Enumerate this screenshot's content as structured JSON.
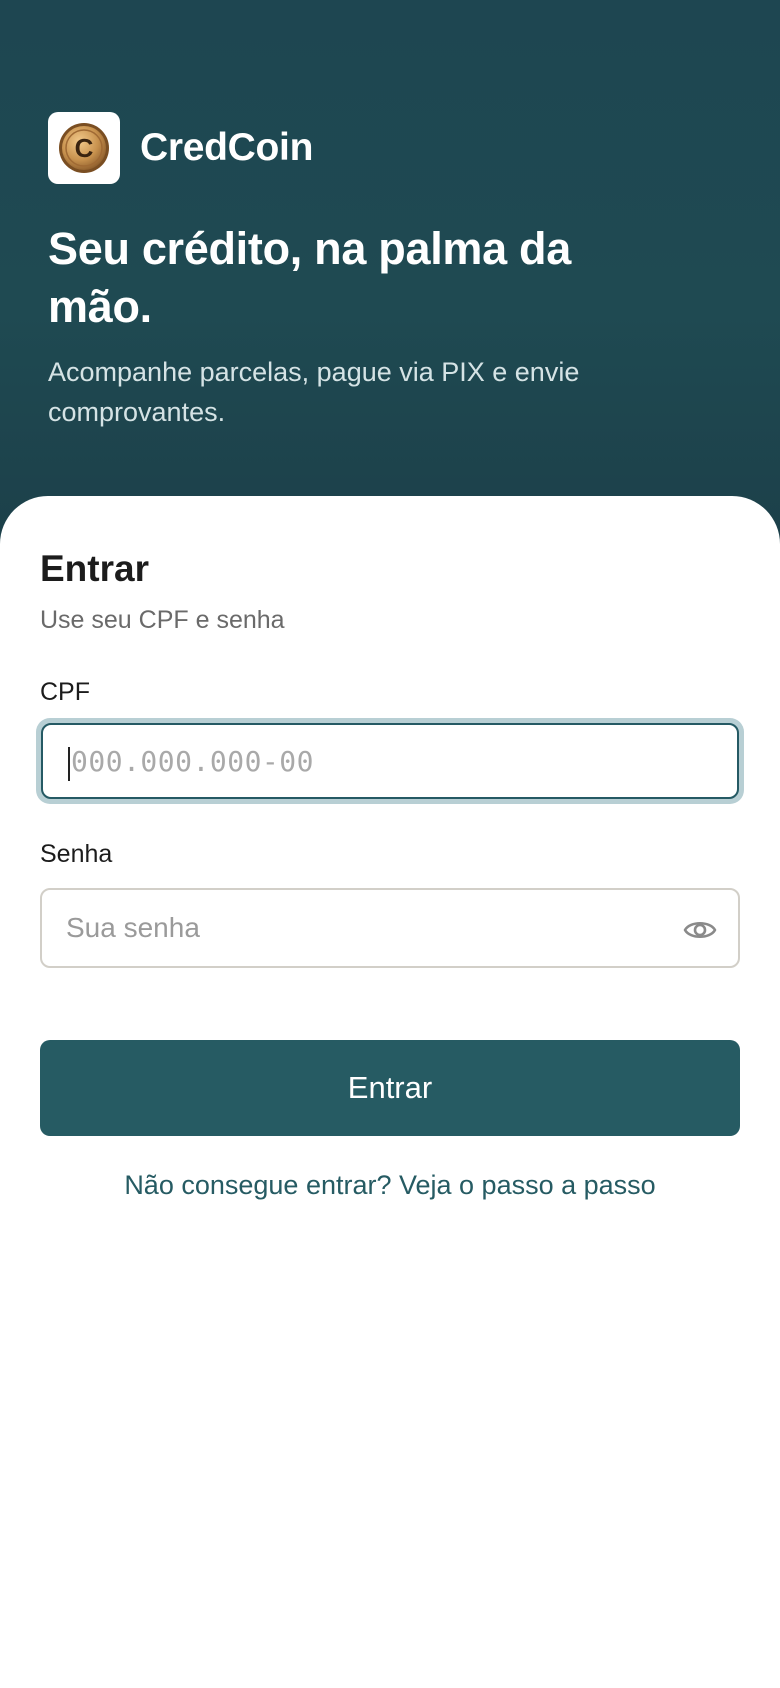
{
  "brand": {
    "name": "CredCoin",
    "logo_icon": "coin-c-icon",
    "logo_letter": "C"
  },
  "hero": {
    "headline": "Seu crédito, na palma da mão.",
    "subtitle": "Acompanhe parcelas, pague via PIX e envie comprovantes."
  },
  "form": {
    "title": "Entrar",
    "subtitle": "Use seu CPF e senha",
    "cpf": {
      "label": "CPF",
      "placeholder": "000.000.000-00",
      "value": ""
    },
    "password": {
      "label": "Senha",
      "placeholder": "Sua senha",
      "value": "",
      "toggle_icon": "eye-icon"
    },
    "submit_label": "Entrar",
    "help_link": "Não consegue entrar? Veja o passo a passo"
  },
  "colors": {
    "primary": "#265b63",
    "hero_bg": "#1e4651",
    "focus_ring": "#b8cfd4",
    "coin_gold": "#c8924e"
  }
}
